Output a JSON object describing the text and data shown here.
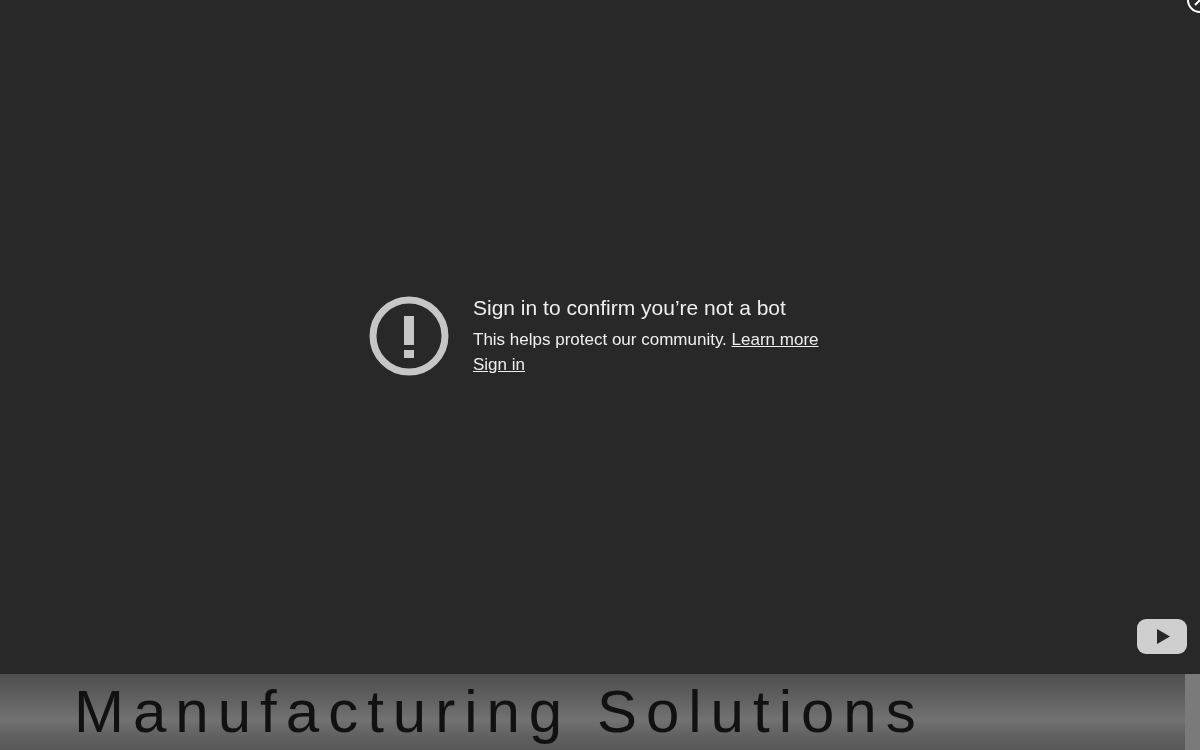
{
  "video_embed": {
    "title": "Sign in to confirm you’re not a bot",
    "message": "This helps protect our community.",
    "learn_more_link": "Learn more",
    "sign_in_link": "Sign in"
  },
  "hero": {
    "heading": "Manufacturing Solutions"
  }
}
